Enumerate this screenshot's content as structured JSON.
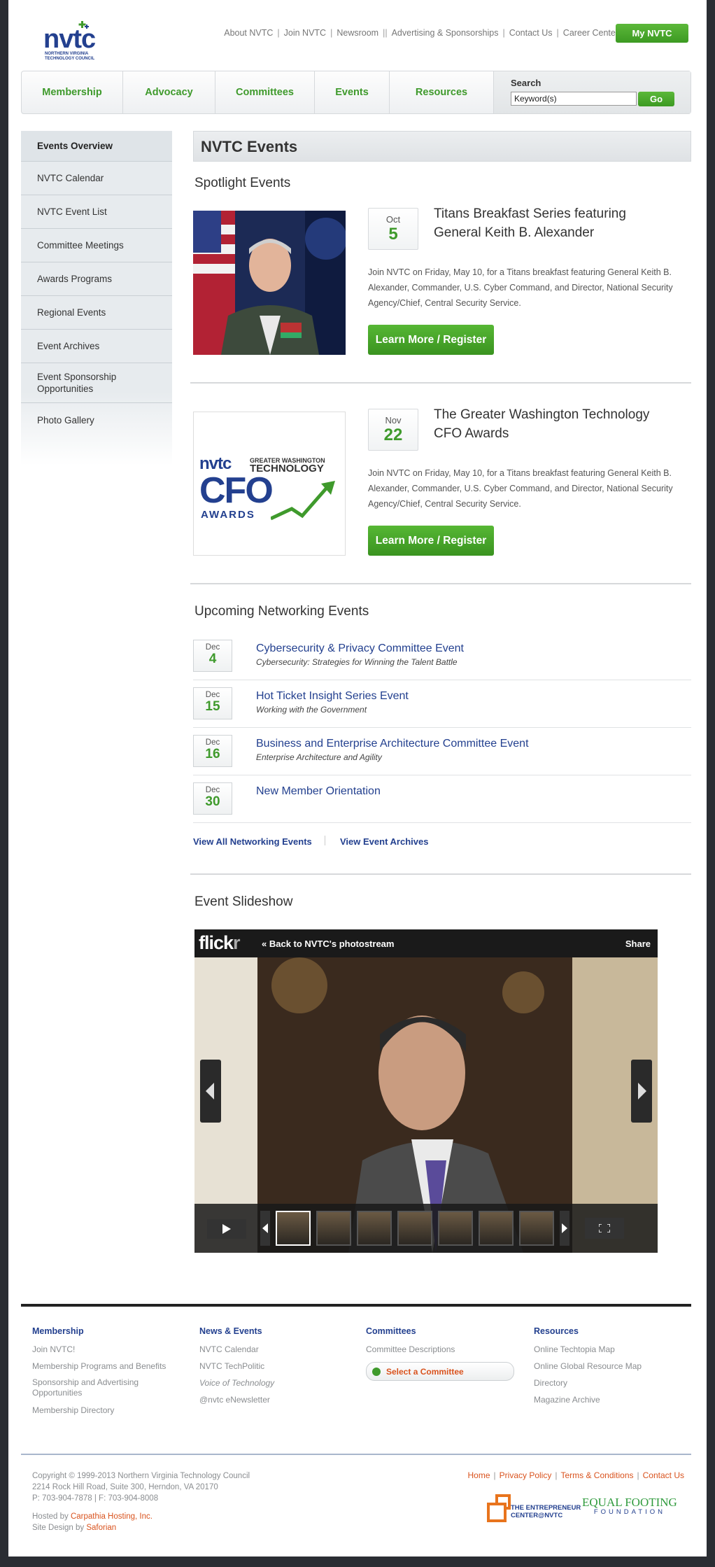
{
  "header": {
    "logo_text": "nvtc",
    "logo_subtext": "NORTHERN VIRGINIA TECHNOLOGY COUNCIL",
    "top_links": [
      "About NVTC",
      "Join NVTC",
      "Newsroom",
      "Advertising & Sponsorships",
      "Contact Us",
      "Career Center"
    ],
    "my_nvtc": "My NVTC"
  },
  "nav": {
    "items": [
      "Membership",
      "Advocacy",
      "Committees",
      "Events",
      "Resources"
    ],
    "search_label": "Search",
    "search_value": "Keyword(s)",
    "go_label": "Go"
  },
  "sidebar": {
    "items": [
      "Events Overview",
      "NVTC Calendar",
      "NVTC Event List",
      "Committee Meetings",
      "Awards Programs",
      "Regional Events",
      "Event Archives",
      "Event Sponsorship Opportunities",
      "Photo Gallery"
    ]
  },
  "main": {
    "title": "NVTC Events",
    "spotlight_heading": "Spotlight Events",
    "spotlight": [
      {
        "month": "Oct",
        "day": "5",
        "title": "Titans Breakfast Series featuring General Keith B. Alexander",
        "desc": "Join NVTC on Friday, May 10, for a Titans breakfast featuring General Keith B. Alexander, Commander, U.S. Cyber Command, and Director, National Security Agency/Chief, Central Security Service.",
        "button": "Learn More / Register"
      },
      {
        "month": "Nov",
        "day": "22",
        "title": "The Greater Washington Technology CFO Awards",
        "desc": "Join NVTC on Friday, May 10, for a Titans breakfast featuring General Keith B. Alexander, Commander, U.S. Cyber Command, and Director, National Security Agency/Chief, Central Security Service.",
        "button": "Learn More / Register"
      }
    ],
    "cfo_logo": {
      "nvtc": "nvtc",
      "greater": "GREATER WASHINGTON",
      "technology": "TECHNOLOGY",
      "cfo": "CFO",
      "awards": "AWARDS"
    },
    "networking_heading": "Upcoming Networking Events",
    "networking": [
      {
        "month": "Dec",
        "day": "4",
        "title": "Cybersecurity & Privacy Committee Event",
        "subtitle": "Cybersecurity: Strategies for Winning the Talent Battle"
      },
      {
        "month": "Dec",
        "day": "15",
        "title": "Hot Ticket Insight Series Event",
        "subtitle": "Working with the Government"
      },
      {
        "month": "Dec",
        "day": "16",
        "title": "Business and Enterprise Architecture Committee Event",
        "subtitle": "Enterprise Architecture and Agility"
      },
      {
        "month": "Dec",
        "day": "30",
        "title": "New Member Orientation",
        "subtitle": ""
      }
    ],
    "view_all": "View All Networking Events",
    "view_archives": "View Event Archives",
    "slideshow_heading": "Event Slideshow",
    "flickr_logo": "flick",
    "flickr_logo_r": "r",
    "flickr_back": "« Back to NVTC's photostream",
    "flickr_share": "Share"
  },
  "footer": {
    "membership": {
      "heading": "Membership",
      "links": [
        "Join NVTC!",
        "Membership Programs and Benefits",
        "Sponsorship and Advertising Opportunities",
        "Membership Directory"
      ]
    },
    "news": {
      "heading": "News & Events",
      "links": [
        "NVTC Calendar",
        "NVTC TechPolitic",
        "Voice of Technology",
        "@nvtc eNewsletter"
      ]
    },
    "committees": {
      "heading": "Committees",
      "links": [
        "Committee Descriptions"
      ],
      "select": "Select a Committee"
    },
    "resources": {
      "heading": "Resources",
      "links": [
        "Online Techtopia Map",
        "Online Global Resource Map",
        "Directory",
        "Magazine Archive"
      ]
    },
    "copyright": "Copyright © 1999-2013 Northern Virginia Technology Council",
    "address": "2214 Rock Hill Road, Suite 300, Herndon, VA 20170",
    "phone": "P: 703-904-7878 | F: 703-904-8008",
    "hosted_prefix": "Hosted by ",
    "hosted_by": "Carpathia Hosting, Inc.",
    "design_prefix": "Site Design by ",
    "design_by": "Saforian",
    "links": [
      "Home",
      "Privacy Policy",
      "Terms & Conditions",
      "Contact Us"
    ],
    "ent_logo_line1": "THE ENTREPRENEUR",
    "ent_logo_line2": "CENTER@NVTC",
    "eq_logo_line1": "EQUAL FOOTING",
    "eq_logo_line2": "FOUNDATION"
  }
}
